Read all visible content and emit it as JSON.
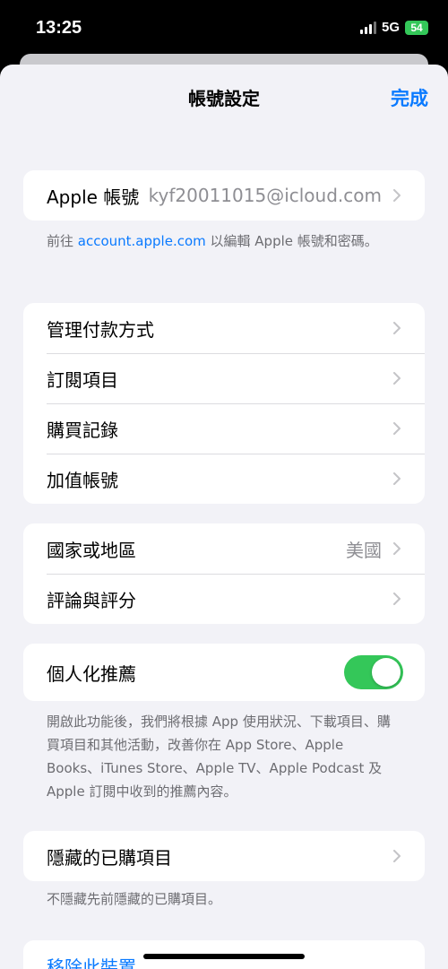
{
  "status_bar": {
    "time": "13:25",
    "network": "5G",
    "battery": "54"
  },
  "nav": {
    "title": "帳號設定",
    "done_label": "完成"
  },
  "account": {
    "label": "Apple 帳號",
    "value": "kyf20011015@icloud.com",
    "footnote_prefix": "前往 ",
    "footnote_link": "account.apple.com",
    "footnote_suffix": " 以編輯 Apple 帳號和密碼。"
  },
  "payment_group": {
    "items": [
      {
        "label": "管理付款方式"
      },
      {
        "label": "訂閱項目"
      },
      {
        "label": "購買記錄"
      },
      {
        "label": "加值帳號"
      }
    ]
  },
  "region_group": {
    "country_label": "國家或地區",
    "country_value": "美國",
    "ratings_label": "評論與評分"
  },
  "personalization": {
    "label": "個人化推薦",
    "enabled": true,
    "footnote": "開啟此功能後，我們將根據 App 使用狀況、下載項目、購買項目和其他活動，改善你在 App Store、Apple Books、iTunes Store、Apple TV、Apple Podcast 及 Apple 訂閱中收到的推薦內容。"
  },
  "hidden_purchases": {
    "label": "隱藏的已購項目",
    "footnote": "不隱藏先前隱藏的已購項目。"
  },
  "remove_device": {
    "label": "移除此裝置"
  },
  "colors": {
    "accent": "#0a7aff",
    "toggle_on": "#34c759",
    "background": "#f2f2f7"
  }
}
